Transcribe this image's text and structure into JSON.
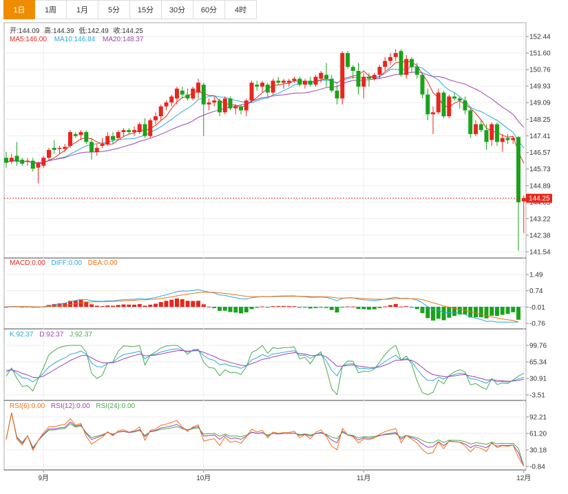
{
  "tabs": [
    "1日",
    "1周",
    "1月",
    "5分",
    "15分",
    "30分",
    "60分",
    "4时"
  ],
  "active_tab": 0,
  "ohlc_header": {
    "open_label": "开:",
    "open": "144.09",
    "high_label": "高:",
    "high": "144.39",
    "low_label": "低:",
    "low": "142.49",
    "close_label": "收:",
    "close": "144.25"
  },
  "ma_header": {
    "ma5_label": "MA5:",
    "ma5": "146.00",
    "ma10_label": "MA10:",
    "ma10": "146.84",
    "ma20_label": "MA20:",
    "ma20": "148.37"
  },
  "macd_header": {
    "macd_label": "MACD:",
    "macd": "0.00",
    "diff_label": "DIFF:",
    "diff": "0.00",
    "dea_label": "DEA:",
    "dea": "0.00"
  },
  "kdj_header": {
    "k_label": "K:",
    "k": "92.37",
    "d_label": "D:",
    "d": "92.37",
    "j_label": "J:",
    "j": "92.37"
  },
  "rsi_header": {
    "rsi6_label": "RSI(6):",
    "rsi6": "0.00",
    "rsi12_label": "RSI(12):",
    "rsi12": "0.00",
    "rsi24_label": "RSI(24):",
    "rsi24": "0.00"
  },
  "last_price": "144.25",
  "colors": {
    "up": "#e8261c",
    "down": "#1aa31a",
    "ma5": "#e8261c",
    "ma10": "#29a8e0",
    "ma20": "#a040b0",
    "diff": "#29a8e0",
    "dea": "#f07010",
    "k": "#29a8e0",
    "d": "#a040b0",
    "j": "#4aaa4a",
    "rsi6": "#f07010",
    "rsi12": "#a040b0",
    "rsi24": "#4aaa4a",
    "accent": "#f08c00"
  },
  "chart_data": [
    {
      "type": "candlestick",
      "y_ticks": [
        "152.44",
        "151.60",
        "150.76",
        "149.93",
        "149.09",
        "148.25",
        "147.41",
        "146.57",
        "145.73",
        "144.89",
        "144.05",
        "143.22",
        "142.38",
        "141.54"
      ],
      "ylim": [
        141.54,
        152.44
      ],
      "x_ticks": [
        {
          "label": "9月",
          "index": 7
        },
        {
          "label": "10月",
          "index": 37
        },
        {
          "label": "11月",
          "index": 67
        },
        {
          "label": "12月",
          "index": 97
        }
      ],
      "candles": [
        {
          "o": 146.3,
          "h": 146.6,
          "l": 145.8,
          "c": 146.05
        },
        {
          "o": 146.1,
          "h": 146.5,
          "l": 146.0,
          "c": 146.3
        },
        {
          "o": 146.4,
          "h": 147.1,
          "l": 145.9,
          "c": 146.1
        },
        {
          "o": 146.2,
          "h": 146.3,
          "l": 145.9,
          "c": 146.0
        },
        {
          "o": 146.1,
          "h": 146.3,
          "l": 145.9,
          "c": 146.15
        },
        {
          "o": 146.15,
          "h": 146.3,
          "l": 145.6,
          "c": 145.75
        },
        {
          "o": 145.8,
          "h": 146.1,
          "l": 145.0,
          "c": 146.0
        },
        {
          "o": 145.9,
          "h": 146.4,
          "l": 145.8,
          "c": 146.3
        },
        {
          "o": 146.3,
          "h": 146.8,
          "l": 146.2,
          "c": 146.7
        },
        {
          "o": 146.8,
          "h": 147.2,
          "l": 146.5,
          "c": 146.7
        },
        {
          "o": 146.75,
          "h": 146.9,
          "l": 146.5,
          "c": 146.8
        },
        {
          "o": 146.75,
          "h": 147.0,
          "l": 146.6,
          "c": 146.85
        },
        {
          "o": 146.9,
          "h": 147.7,
          "l": 146.8,
          "c": 147.6
        },
        {
          "o": 147.5,
          "h": 147.6,
          "l": 147.3,
          "c": 147.4
        },
        {
          "o": 147.45,
          "h": 147.7,
          "l": 147.2,
          "c": 147.6
        },
        {
          "o": 147.6,
          "h": 147.7,
          "l": 147.0,
          "c": 147.1
        },
        {
          "o": 147.1,
          "h": 147.3,
          "l": 146.2,
          "c": 146.6
        },
        {
          "o": 146.6,
          "h": 147.0,
          "l": 146.4,
          "c": 146.8
        },
        {
          "o": 146.9,
          "h": 147.3,
          "l": 146.8,
          "c": 147.0
        },
        {
          "o": 147.0,
          "h": 147.6,
          "l": 146.9,
          "c": 147.4
        },
        {
          "o": 147.4,
          "h": 147.6,
          "l": 147.0,
          "c": 147.2
        },
        {
          "o": 147.3,
          "h": 147.7,
          "l": 147.2,
          "c": 147.6
        },
        {
          "o": 147.6,
          "h": 147.8,
          "l": 147.4,
          "c": 147.7
        },
        {
          "o": 147.7,
          "h": 147.8,
          "l": 147.5,
          "c": 147.6
        },
        {
          "o": 147.6,
          "h": 147.9,
          "l": 147.4,
          "c": 147.7
        },
        {
          "o": 147.6,
          "h": 148.1,
          "l": 147.5,
          "c": 148.0
        },
        {
          "o": 148.0,
          "h": 148.3,
          "l": 147.3,
          "c": 147.4
        },
        {
          "o": 147.4,
          "h": 148.3,
          "l": 147.3,
          "c": 148.2
        },
        {
          "o": 148.2,
          "h": 148.6,
          "l": 148.0,
          "c": 148.4
        },
        {
          "o": 148.4,
          "h": 149.0,
          "l": 148.2,
          "c": 148.9
        },
        {
          "o": 148.9,
          "h": 149.2,
          "l": 148.7,
          "c": 149.1
        },
        {
          "o": 149.1,
          "h": 149.5,
          "l": 148.9,
          "c": 149.4
        },
        {
          "o": 149.3,
          "h": 149.9,
          "l": 149.0,
          "c": 149.8
        },
        {
          "o": 149.7,
          "h": 149.9,
          "l": 149.3,
          "c": 149.5
        },
        {
          "o": 149.5,
          "h": 149.8,
          "l": 149.2,
          "c": 149.3
        },
        {
          "o": 149.3,
          "h": 149.9,
          "l": 149.2,
          "c": 149.8
        },
        {
          "o": 149.6,
          "h": 150.3,
          "l": 149.3,
          "c": 150.1
        },
        {
          "o": 150.0,
          "h": 150.1,
          "l": 147.4,
          "c": 149.0
        },
        {
          "o": 149.0,
          "h": 149.3,
          "l": 148.7,
          "c": 149.1
        },
        {
          "o": 149.1,
          "h": 149.4,
          "l": 148.9,
          "c": 149.2
        },
        {
          "o": 149.2,
          "h": 149.3,
          "l": 148.4,
          "c": 148.6
        },
        {
          "o": 148.6,
          "h": 149.4,
          "l": 148.5,
          "c": 149.3
        },
        {
          "o": 149.3,
          "h": 149.4,
          "l": 148.7,
          "c": 148.8
        },
        {
          "o": 148.8,
          "h": 149.0,
          "l": 148.5,
          "c": 148.9
        },
        {
          "o": 148.9,
          "h": 149.0,
          "l": 148.5,
          "c": 148.7
        },
        {
          "o": 148.7,
          "h": 149.3,
          "l": 148.4,
          "c": 149.2
        },
        {
          "o": 149.2,
          "h": 150.2,
          "l": 149.1,
          "c": 150.1
        },
        {
          "o": 150.0,
          "h": 150.2,
          "l": 149.7,
          "c": 149.9
        },
        {
          "o": 149.9,
          "h": 150.2,
          "l": 149.6,
          "c": 150.1
        },
        {
          "o": 150.0,
          "h": 150.1,
          "l": 149.4,
          "c": 149.6
        },
        {
          "o": 149.6,
          "h": 150.3,
          "l": 149.5,
          "c": 150.2
        },
        {
          "o": 150.2,
          "h": 150.4,
          "l": 150.0,
          "c": 150.1
        },
        {
          "o": 150.1,
          "h": 150.3,
          "l": 149.8,
          "c": 150.2
        },
        {
          "o": 150.1,
          "h": 150.3,
          "l": 149.9,
          "c": 150.2
        },
        {
          "o": 150.2,
          "h": 150.4,
          "l": 150.1,
          "c": 150.3
        },
        {
          "o": 150.3,
          "h": 150.4,
          "l": 149.9,
          "c": 150.0
        },
        {
          "o": 150.0,
          "h": 150.3,
          "l": 149.8,
          "c": 150.2
        },
        {
          "o": 150.2,
          "h": 150.4,
          "l": 149.9,
          "c": 150.0
        },
        {
          "o": 150.0,
          "h": 150.5,
          "l": 149.9,
          "c": 150.4
        },
        {
          "o": 150.3,
          "h": 150.7,
          "l": 150.1,
          "c": 150.6
        },
        {
          "o": 150.5,
          "h": 151.1,
          "l": 149.9,
          "c": 150.3
        },
        {
          "o": 150.3,
          "h": 150.5,
          "l": 149.6,
          "c": 149.7
        },
        {
          "o": 149.7,
          "h": 150.0,
          "l": 149.0,
          "c": 149.3
        },
        {
          "o": 149.3,
          "h": 151.7,
          "l": 149.0,
          "c": 151.6
        },
        {
          "o": 151.6,
          "h": 151.7,
          "l": 150.8,
          "c": 150.9
        },
        {
          "o": 150.9,
          "h": 151.0,
          "l": 150.3,
          "c": 150.7
        },
        {
          "o": 150.7,
          "h": 151.1,
          "l": 149.5,
          "c": 149.9
        },
        {
          "o": 149.9,
          "h": 150.6,
          "l": 149.3,
          "c": 150.4
        },
        {
          "o": 150.4,
          "h": 150.6,
          "l": 149.9,
          "c": 150.3
        },
        {
          "o": 150.3,
          "h": 150.6,
          "l": 150.2,
          "c": 150.5
        },
        {
          "o": 150.5,
          "h": 151.0,
          "l": 150.3,
          "c": 150.9
        },
        {
          "o": 150.9,
          "h": 151.4,
          "l": 150.7,
          "c": 151.2
        },
        {
          "o": 151.2,
          "h": 151.6,
          "l": 151.0,
          "c": 151.4
        },
        {
          "o": 151.4,
          "h": 151.8,
          "l": 151.2,
          "c": 151.6
        },
        {
          "o": 151.7,
          "h": 151.8,
          "l": 150.4,
          "c": 150.5
        },
        {
          "o": 150.5,
          "h": 151.5,
          "l": 150.3,
          "c": 151.3
        },
        {
          "o": 151.3,
          "h": 151.4,
          "l": 150.6,
          "c": 150.9
        },
        {
          "o": 150.9,
          "h": 151.1,
          "l": 150.3,
          "c": 150.5
        },
        {
          "o": 150.5,
          "h": 150.6,
          "l": 149.3,
          "c": 149.5
        },
        {
          "o": 149.5,
          "h": 149.8,
          "l": 148.2,
          "c": 148.5
        },
        {
          "o": 148.5,
          "h": 148.9,
          "l": 147.5,
          "c": 148.6
        },
        {
          "o": 148.6,
          "h": 149.8,
          "l": 148.5,
          "c": 149.6
        },
        {
          "o": 149.6,
          "h": 149.7,
          "l": 148.3,
          "c": 148.4
        },
        {
          "o": 148.4,
          "h": 149.5,
          "l": 148.3,
          "c": 149.4
        },
        {
          "o": 149.4,
          "h": 149.6,
          "l": 149.2,
          "c": 149.3
        },
        {
          "o": 149.3,
          "h": 149.4,
          "l": 148.8,
          "c": 149.2
        },
        {
          "o": 149.2,
          "h": 149.4,
          "l": 148.5,
          "c": 148.7
        },
        {
          "o": 148.7,
          "h": 148.8,
          "l": 147.3,
          "c": 147.5
        },
        {
          "o": 147.5,
          "h": 148.2,
          "l": 147.4,
          "c": 148.0
        },
        {
          "o": 148.0,
          "h": 148.2,
          "l": 147.6,
          "c": 147.7
        },
        {
          "o": 147.7,
          "h": 148.0,
          "l": 146.7,
          "c": 147.1
        },
        {
          "o": 147.2,
          "h": 148.1,
          "l": 146.9,
          "c": 148.0
        },
        {
          "o": 148.0,
          "h": 148.1,
          "l": 146.9,
          "c": 147.1
        },
        {
          "o": 147.1,
          "h": 147.5,
          "l": 146.6,
          "c": 147.3
        },
        {
          "o": 147.3,
          "h": 147.5,
          "l": 147.0,
          "c": 147.2
        },
        {
          "o": 147.2,
          "h": 147.4,
          "l": 147.0,
          "c": 147.3
        },
        {
          "o": 147.35,
          "h": 147.4,
          "l": 141.6,
          "c": 144.05
        },
        {
          "o": 144.09,
          "h": 144.39,
          "l": 142.49,
          "c": 144.25
        }
      ]
    },
    {
      "type": "bar",
      "name": "MACD",
      "y_ticks": [
        "1.49",
        "0.74",
        "-0.01",
        "-0.76"
      ],
      "ylim": [
        -0.76,
        1.49
      ]
    },
    {
      "type": "line",
      "name": "KDJ",
      "y_ticks": [
        "99.76",
        "65.34",
        "30.91",
        "-3.51"
      ],
      "ylim": [
        -3.51,
        99.76
      ]
    },
    {
      "type": "line",
      "name": "RSI",
      "y_ticks": [
        "92.21",
        "61.20",
        "30.18",
        "-0.84"
      ],
      "ylim": [
        -0.84,
        92.21
      ]
    }
  ]
}
